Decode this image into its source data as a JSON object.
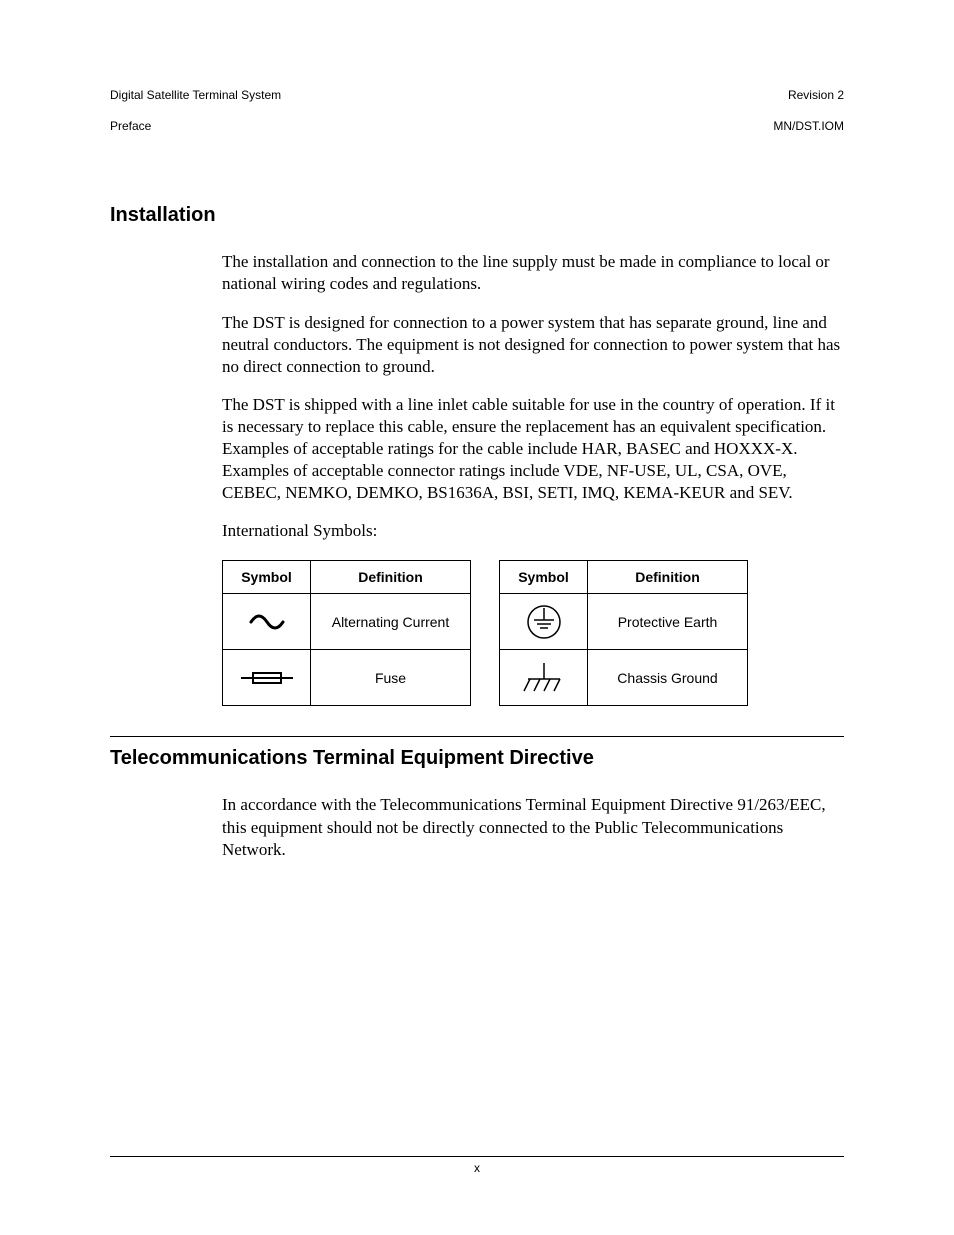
{
  "header": {
    "left_line1": "Digital Satellite Terminal System",
    "left_line2": "Preface",
    "right_line1": "Revision 2",
    "right_line2": "MN/DST.IOM"
  },
  "sections": {
    "installation": {
      "heading": "Installation",
      "p1": "The installation and connection to the line supply must be made in compliance to local or national wiring codes and regulations.",
      "p2": "The DST is designed for connection to a power system that has separate ground, line and neutral conductors. The equipment is not designed for connection to power system that has no direct connection to ground.",
      "p3": "The DST is shipped with a line inlet cable suitable for use in the country of operation. If it is necessary to replace this cable, ensure the replacement has an equivalent specification. Examples of acceptable ratings for the cable include HAR, BASEC and HOXXX-X. Examples of acceptable connector ratings include VDE, NF-USE, UL, CSA, OVE, CEBEC, NEMKO, DEMKO, BS1636A, BSI, SETI, IMQ, KEMA-KEUR and SEV.",
      "p4": "International Symbols:"
    },
    "tte": {
      "heading": "Telecommunications Terminal Equipment Directive",
      "p1": "In accordance with the Telecommunications Terminal Equipment Directive 91/263/EEC, this equipment should not be directly connected to the Public Telecommunications Network."
    }
  },
  "tables": {
    "col_symbol": "Symbol",
    "col_definition": "Definition",
    "left": [
      {
        "icon": "ac",
        "definition": "Alternating Current"
      },
      {
        "icon": "fuse",
        "definition": "Fuse"
      }
    ],
    "right": [
      {
        "icon": "protective-earth",
        "definition": "Protective Earth"
      },
      {
        "icon": "chassis-ground",
        "definition": "Chassis Ground"
      }
    ]
  },
  "footer": {
    "page_number": "x"
  }
}
